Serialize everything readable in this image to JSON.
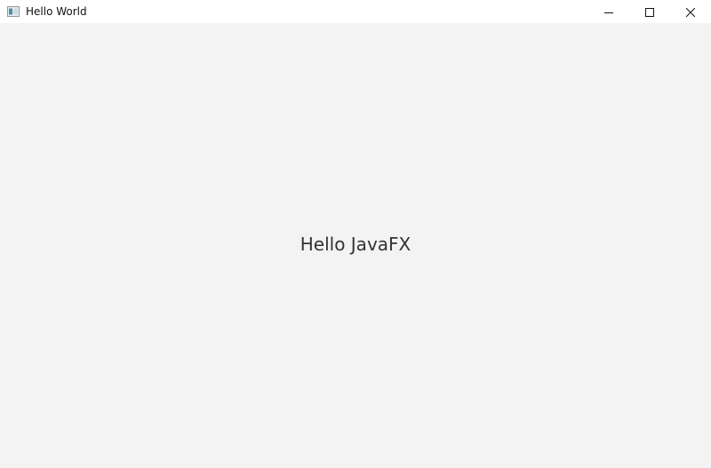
{
  "window": {
    "title": "Hello World",
    "app_icon": "java-app-icon",
    "controls": {
      "minimize_icon": "minimize-icon",
      "maximize_icon": "maximize-icon",
      "close_icon": "close-icon"
    }
  },
  "content": {
    "label": "Hello JavaFX"
  },
  "colors": {
    "titlebar_bg": "#ffffff",
    "content_bg": "#f3f3f3",
    "label_color": "#333333"
  }
}
